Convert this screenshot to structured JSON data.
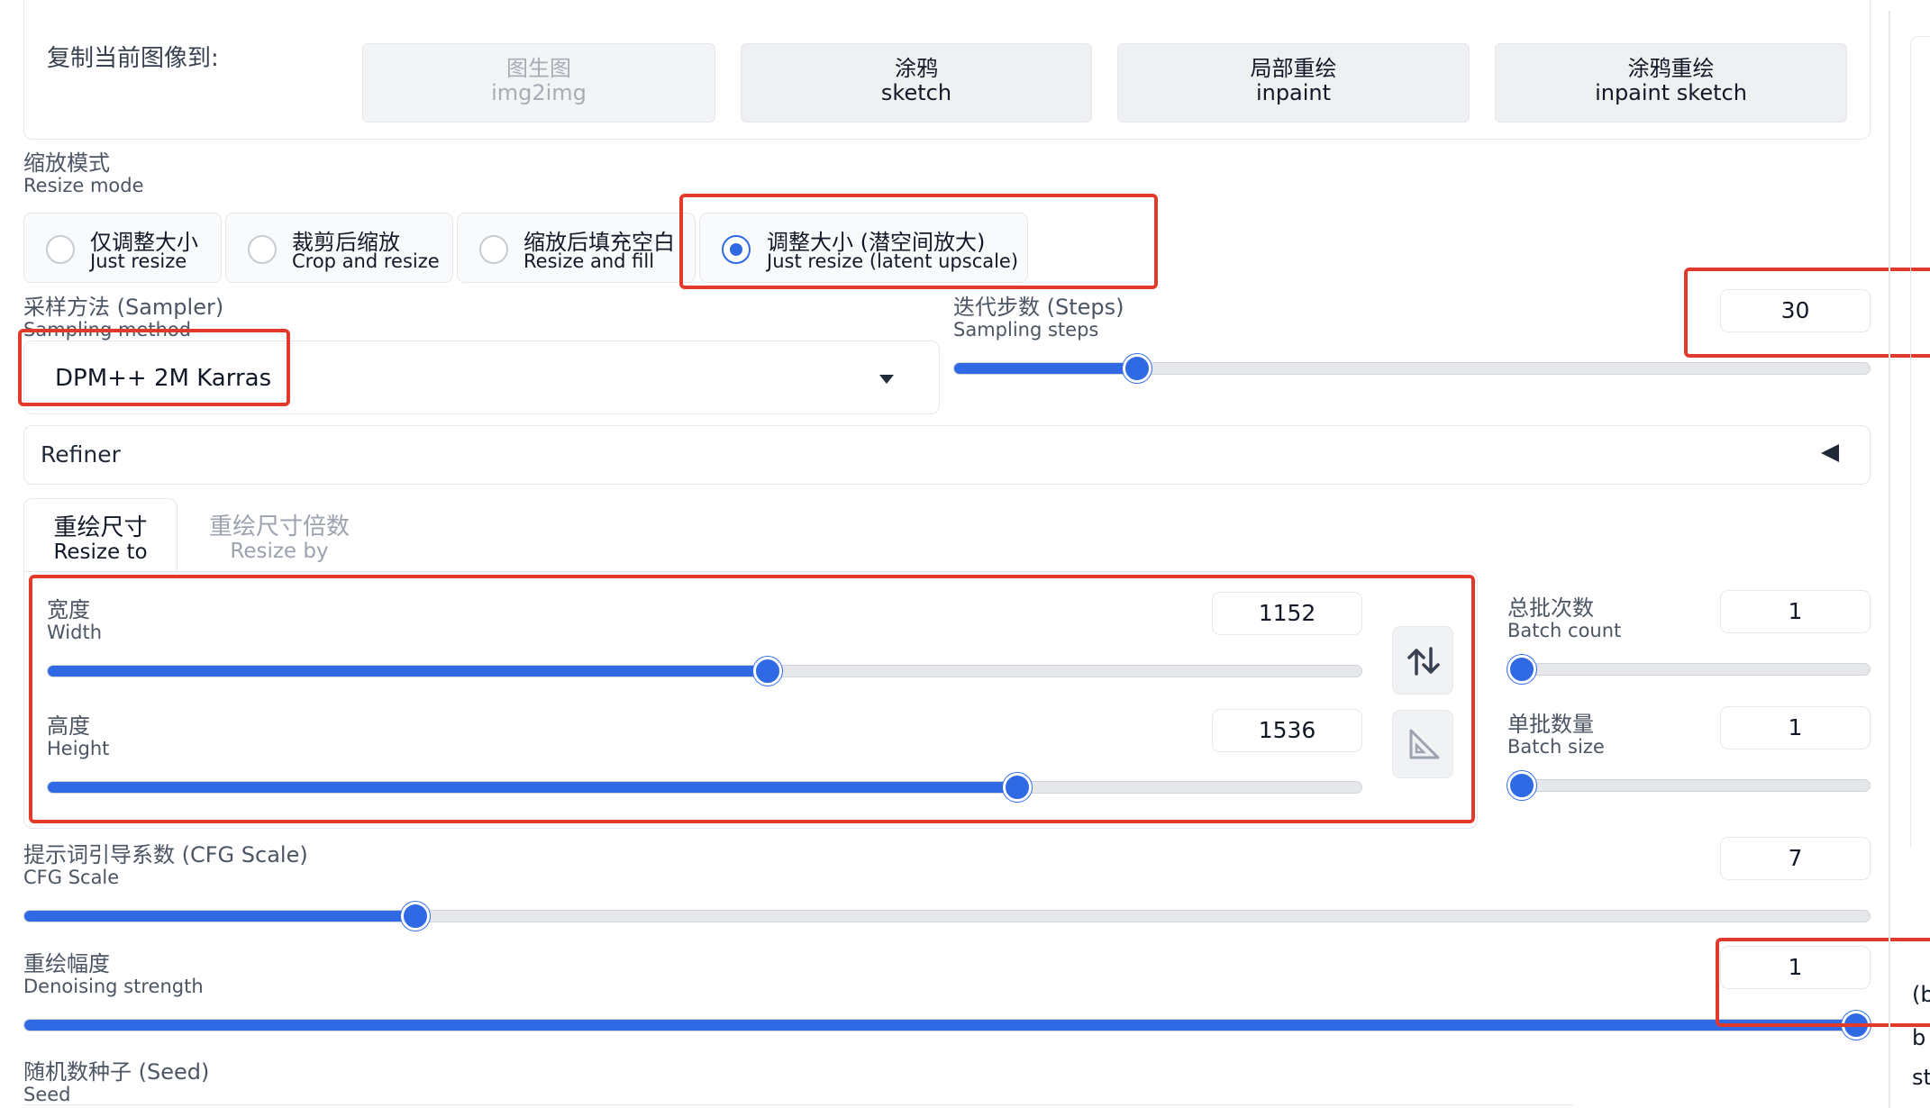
{
  "copy_section": {
    "label": "复制当前图像到:",
    "buttons": [
      {
        "zh": "图生图",
        "en": "img2img",
        "disabled": true
      },
      {
        "zh": "涂鸦",
        "en": "sketch",
        "disabled": false
      },
      {
        "zh": "局部重绘",
        "en": "inpaint",
        "disabled": false
      },
      {
        "zh": "涂鸦重绘",
        "en": "inpaint sketch",
        "disabled": false
      }
    ]
  },
  "resize_mode": {
    "label_zh": "缩放模式",
    "label_en": "Resize mode",
    "options": [
      {
        "zh": "仅调整大小",
        "en": "Just resize",
        "selected": false
      },
      {
        "zh": "裁剪后缩放",
        "en": "Crop and resize",
        "selected": false
      },
      {
        "zh": "缩放后填充空白",
        "en": "Resize and fill",
        "selected": false
      },
      {
        "zh": "调整大小 (潜空间放大)",
        "en": "Just resize (latent upscale)",
        "selected": true
      }
    ]
  },
  "sampler": {
    "label_zh": "采样方法 (Sampler)",
    "label_en": "Sampling method",
    "value": "DPM++ 2M Karras"
  },
  "steps": {
    "label_zh": "迭代步数 (Steps)",
    "label_en": "Sampling steps",
    "value": "30",
    "fraction": 0.2
  },
  "refiner": {
    "label": "Refiner"
  },
  "size_tabs": [
    {
      "zh": "重绘尺寸",
      "en": "Resize to",
      "active": true
    },
    {
      "zh": "重绘尺寸倍数",
      "en": "Resize by",
      "active": false
    }
  ],
  "width": {
    "label_zh": "宽度",
    "label_en": "Width",
    "value": "1152",
    "fraction": 0.548
  },
  "height": {
    "label_zh": "高度",
    "label_en": "Height",
    "value": "1536",
    "fraction": 0.738
  },
  "batch_count": {
    "label_zh": "总批次数",
    "label_en": "Batch count",
    "value": "1",
    "fraction": 0.0
  },
  "batch_size": {
    "label_zh": "单批数量",
    "label_en": "Batch size",
    "value": "1",
    "fraction": 0.0
  },
  "cfg": {
    "label_zh": "提示词引导系数 (CFG Scale)",
    "label_en": "CFG Scale",
    "value": "7",
    "fraction": 0.212
  },
  "denoise": {
    "label_zh": "重绘幅度",
    "label_en": "Denoising strength",
    "value": "1",
    "fraction": 1.0
  },
  "seed": {
    "label_zh": "随机数种子 (Seed)",
    "label_en": "Seed"
  },
  "right_edge_fragments": [
    "(b",
    "b",
    "st"
  ],
  "colors": {
    "accent": "#2f6ae4",
    "highlight_box": "#e23a2a"
  },
  "icons": {
    "swap": "swap-vertical-arrows-icon",
    "aspect": "triangle-ruler-icon",
    "dropdown": "caret-down-icon",
    "refiner_toggle": "caret-left-icon"
  }
}
